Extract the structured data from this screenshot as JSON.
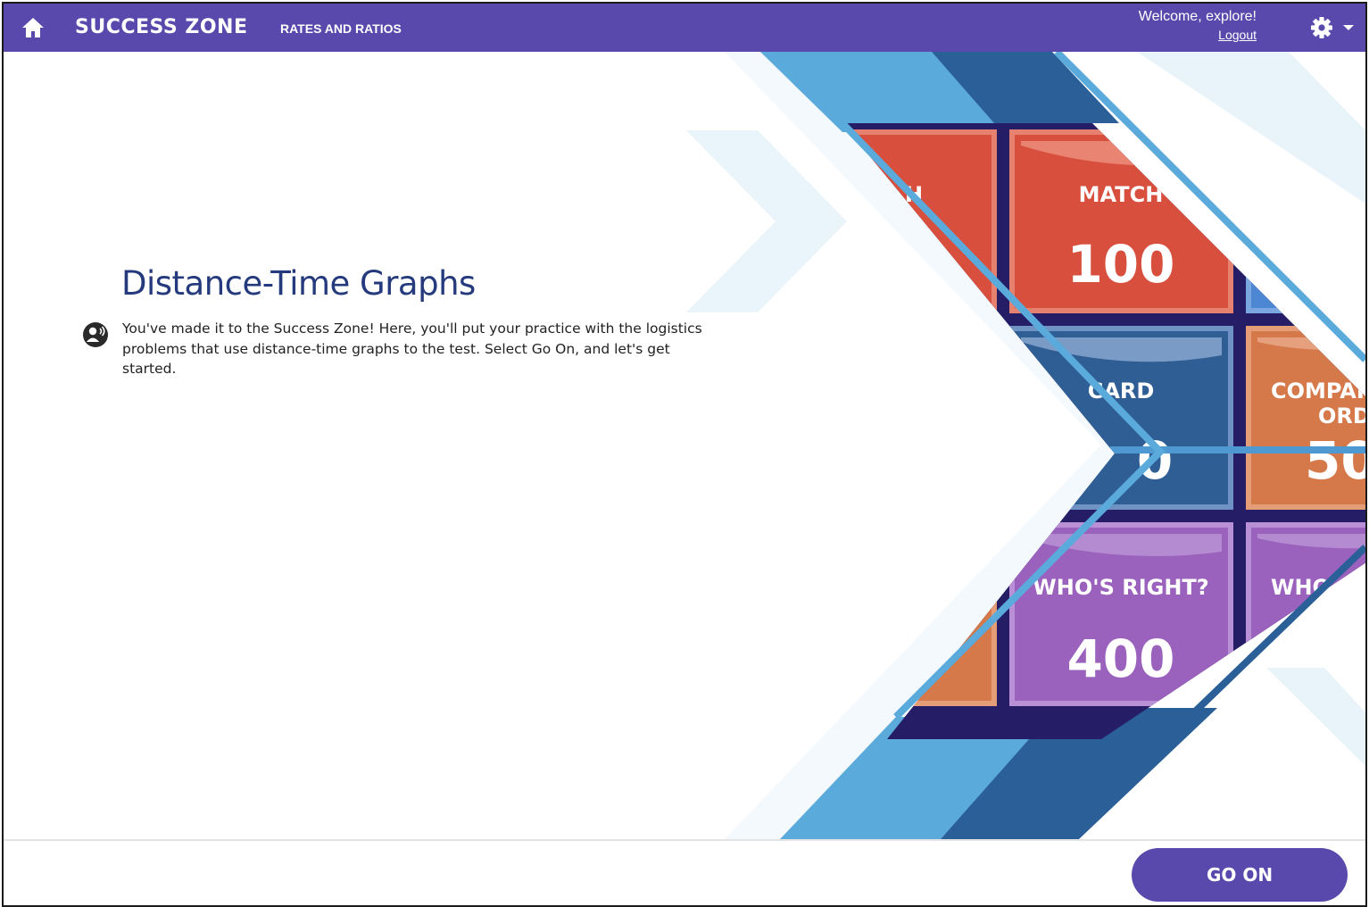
{
  "header": {
    "app_title": "SUCCESS ZONE",
    "section_title": "RATES AND RATIOS",
    "welcome_text": "Welcome, explore!",
    "logout_label": "Logout"
  },
  "icons": {
    "home": "home-icon",
    "settings": "gear-icon",
    "dropdown": "caret-down-icon",
    "audio": "audio-speaker-icon"
  },
  "main": {
    "title": "Distance-Time Graphs",
    "intro": "You've made it to the Success Zone! Here, you'll put your practice with the logistics problems that use distance-time graphs to the test. Select Go On, and let's get started."
  },
  "game_board": {
    "tiles": [
      {
        "label": "H"
      },
      {
        "label": "MATCH",
        "points": "100"
      },
      {
        "label": "CARD",
        "points": "0"
      },
      {
        "label": "COMPAR",
        "label_line2": "ORD",
        "points": "50"
      },
      {
        "label": "WHO'S RIGHT?",
        "points": "400"
      },
      {
        "label": "WHO"
      }
    ]
  },
  "footer": {
    "go_on_label": "GO ON"
  },
  "colors": {
    "brand_purple": "#5a49ad",
    "title_blue": "#243a7c",
    "tile_red": "#d84f3e",
    "tile_blue": "#2f5e95",
    "tile_orange": "#d5784a",
    "tile_purple": "#9a62bd",
    "board_navy": "#251d66",
    "stripe_light": "#5aaadc",
    "stripe_dark": "#2b5f98"
  }
}
